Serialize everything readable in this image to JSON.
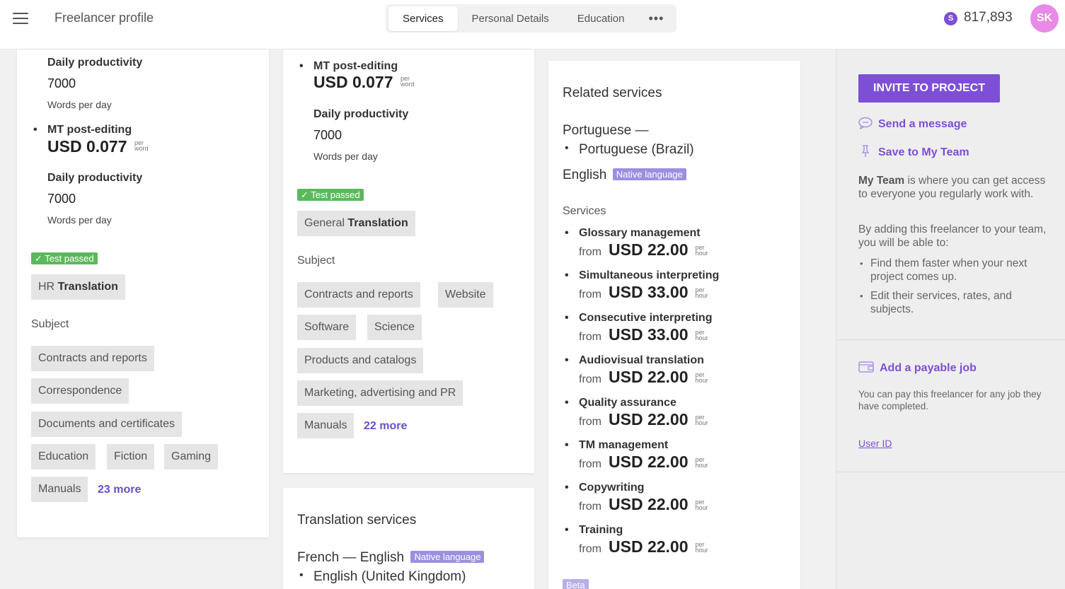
{
  "header": {
    "title": "Freelancer profile",
    "tabs": [
      "Services",
      "Personal Details",
      "Education"
    ],
    "more": "•••",
    "balance_icon": "S",
    "balance": "817,893",
    "avatar": "SK"
  },
  "col1": {
    "prod1_label": "Daily productivity",
    "prod1_value": "7000",
    "prod1_unit": "Words per day",
    "mt_label": "MT post-editing",
    "mt_price": "USD 0.077",
    "mt_per1": "per",
    "mt_per2": "word",
    "prod2_label": "Daily productivity",
    "prod2_value": "7000",
    "prod2_unit": "Words per day",
    "test": "✓ Test passed",
    "service_prefix": "HR",
    "service_name": "Translation",
    "subject_title": "Subject",
    "subjects": [
      "Contracts and reports",
      "Correspondence",
      "Documents and certificates",
      "Education",
      "Fiction",
      "Gaming",
      "Manuals"
    ],
    "more": "23 more"
  },
  "col2": {
    "mt_label": "MT post-editing",
    "mt_price": "USD 0.077",
    "mt_per1": "per",
    "mt_per2": "word",
    "prod_label": "Daily productivity",
    "prod_value": "7000",
    "prod_unit": "Words per day",
    "test": "✓ Test passed",
    "service_prefix": "General",
    "service_name": "Translation",
    "subject_title": "Subject",
    "subjects": [
      "Contracts and reports",
      "Website",
      "Software",
      "Science",
      "Products and catalogs",
      "Marketing, advertising and PR",
      "Manuals"
    ],
    "more": "22 more",
    "translation_title": "Translation services",
    "pair": "French — English",
    "native": "Native language",
    "target": "English (United Kingdom)"
  },
  "col3": {
    "title": "Related services",
    "source": "Portuguese —",
    "target": "Portuguese (Brazil)",
    "lang2": "English",
    "native": "Native language",
    "services_title": "Services",
    "from": "from",
    "per1": "per",
    "per2": "hour",
    "services": [
      {
        "name": "Glossary management",
        "price": "USD 22.00"
      },
      {
        "name": "Simultaneous interpreting",
        "price": "USD 33.00"
      },
      {
        "name": "Consecutive interpreting",
        "price": "USD 33.00"
      },
      {
        "name": "Audiovisual translation",
        "price": "USD 22.00"
      },
      {
        "name": "Quality assurance",
        "price": "USD 22.00"
      },
      {
        "name": "TM management",
        "price": "USD 22.00"
      },
      {
        "name": "Copywriting",
        "price": "USD 22.00"
      },
      {
        "name": "Training",
        "price": "USD 22.00"
      }
    ],
    "beta": "Beta"
  },
  "sidebar": {
    "invite": "INVITE TO PROJECT",
    "send_message": "Send a message",
    "save_team": "Save to My Team",
    "team_bold": "My Team",
    "team_text": " is where you can get access to everyone you regularly work with.",
    "adding_text": "By adding this freelancer to your team, you will be able to:",
    "bullets": [
      "Find them faster when your next project comes up.",
      "Edit their services, rates, and subjects."
    ],
    "add_job": "Add a payable job",
    "job_text": "You can pay this freelancer for any job they have completed.",
    "user_id": "User ID"
  },
  "colors": {
    "accent": "#7d4fd6",
    "test_green": "#5cb85c",
    "native_badge": "#9a8fe0"
  }
}
